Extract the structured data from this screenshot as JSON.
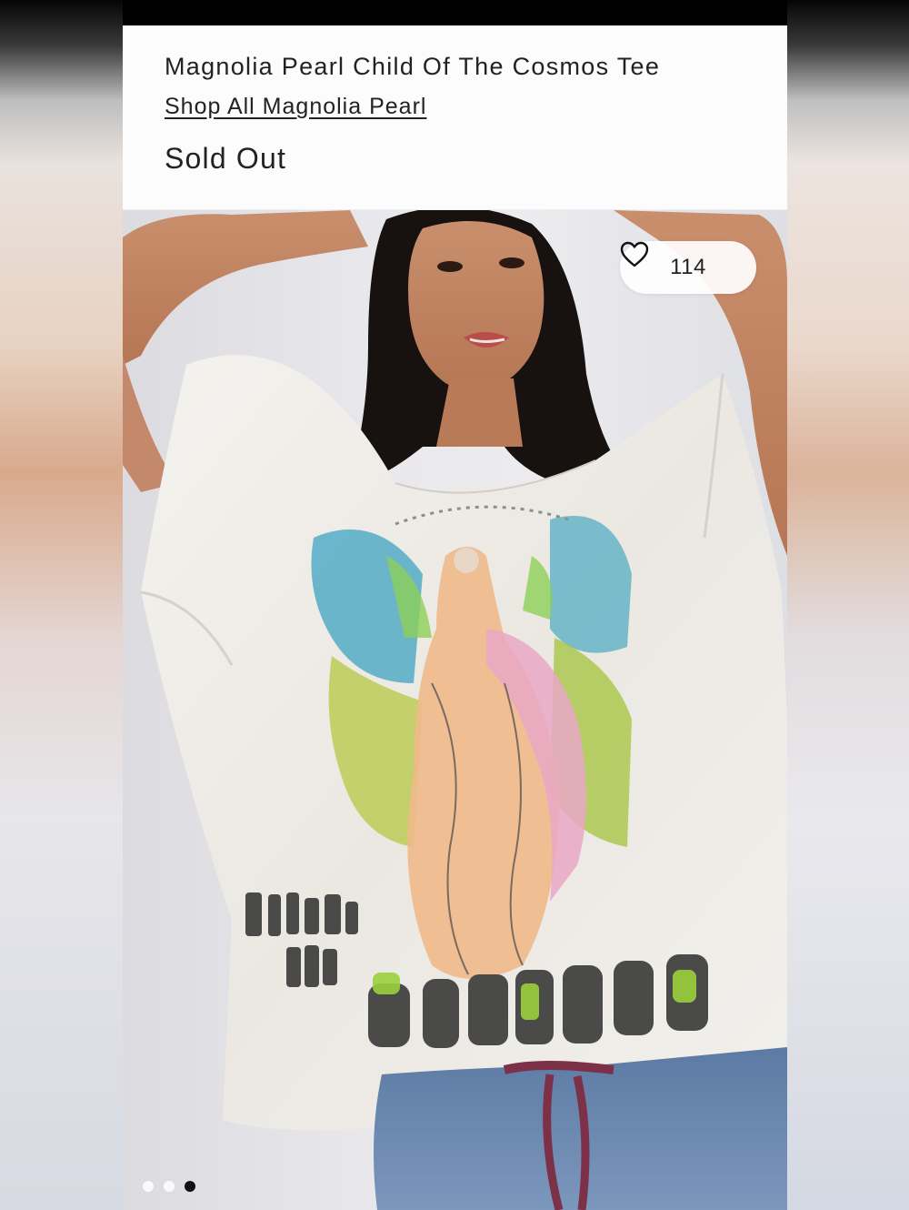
{
  "product": {
    "title": "Magnolia Pearl Child Of The Cosmos Tee",
    "brand_link": "Shop All Magnolia Pearl",
    "status": "Sold Out"
  },
  "gallery": {
    "like_count": "114",
    "like_icon": "heart-outline-icon",
    "image_subject": "model wearing oversized white graphic tee",
    "shirt_print_lines": [
      "CHILD OF",
      "THE",
      "Cosmos"
    ],
    "pagination": {
      "total": 3,
      "active_index": 2
    }
  },
  "colors": {
    "text": "#222222",
    "background": "#fdfcfc",
    "status_bar": "#000000",
    "dot_active": "#111111",
    "dot_inactive": "#ffffff"
  }
}
